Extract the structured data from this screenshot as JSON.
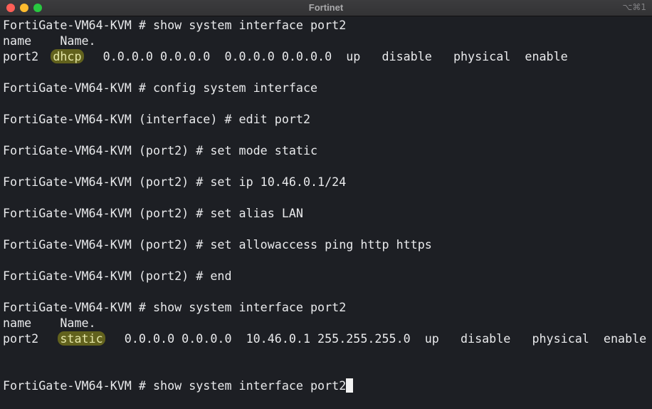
{
  "window": {
    "title": "Fortinet",
    "shortcut": "⌥⌘1"
  },
  "terminal": {
    "l1": "FortiGate-VM64-KVM # show system interface port2",
    "l2": "name    Name.",
    "l3": {
      "a": "port2  ",
      "b": "dhcp",
      "c": "   0.0.0.0 0.0.0.0  0.0.0.0 0.0.0.0  up   disable   physical  enable"
    },
    "l5": "FortiGate-VM64-KVM # config system interface",
    "l7": "FortiGate-VM64-KVM (interface) # edit port2",
    "l9": "FortiGate-VM64-KVM (port2) # set mode static",
    "l11": "FortiGate-VM64-KVM (port2) # set ip 10.46.0.1/24",
    "l13": "FortiGate-VM64-KVM (port2) # set alias LAN",
    "l15": "FortiGate-VM64-KVM (port2) # set allowaccess ping http https",
    "l17": "FortiGate-VM64-KVM (port2) # end",
    "l19": "FortiGate-VM64-KVM # show system interface port2",
    "l20": "name    Name.",
    "l21": {
      "a": "port2   ",
      "b": "static",
      "c": "   0.0.0.0 0.0.0.0  10.46.0.1 255.255.255.0  up   disable   physical  enable"
    },
    "l24": "FortiGate-VM64-KVM # show system interface port2"
  }
}
